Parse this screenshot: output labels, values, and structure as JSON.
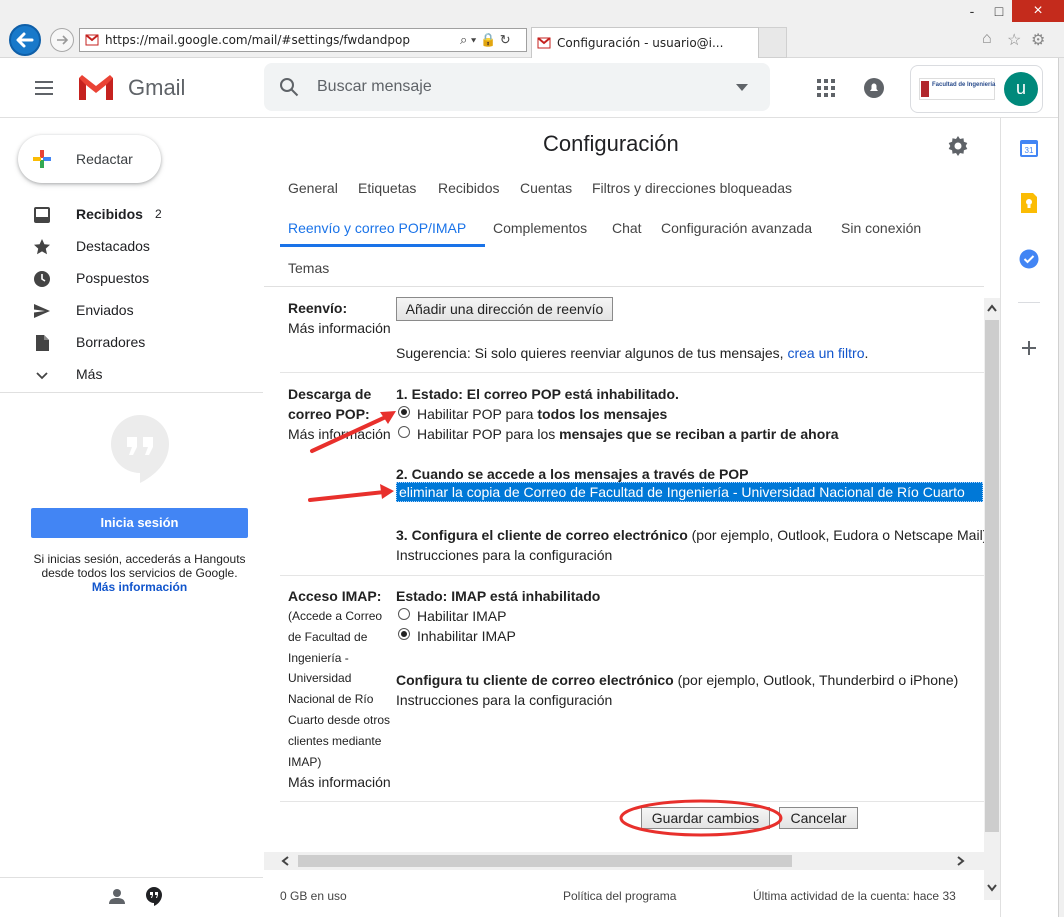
{
  "browser": {
    "url": "https://mail.google.com/mail/#settings/fwdandpop",
    "tab_title": "Configuración - usuario@i...",
    "window_buttons": [
      "-",
      "□",
      "×"
    ]
  },
  "header": {
    "app_name": "Gmail",
    "search_placeholder": "Buscar mensaje",
    "avatar_letter": "u",
    "account_logo_text": "Facultad de Ingeniería"
  },
  "sidebar": {
    "compose": "Redactar",
    "items": [
      {
        "label": "Recibidos",
        "count": "2",
        "icon": "inbox-icon"
      },
      {
        "label": "Destacados",
        "icon": "star-icon"
      },
      {
        "label": "Pospuestos",
        "icon": "clock-icon"
      },
      {
        "label": "Enviados",
        "icon": "send-icon"
      },
      {
        "label": "Borradores",
        "icon": "draft-icon"
      },
      {
        "label": "Más",
        "icon": "chevron-down-icon"
      }
    ],
    "hangouts": {
      "button": "Inicia sesión",
      "text": "Si inicias sesión, accederás a Hangouts desde todos los servicios de Google.",
      "link": "Más información"
    }
  },
  "settings": {
    "title": "Configuración",
    "tabs": [
      "General",
      "Etiquetas",
      "Recibidos",
      "Cuentas",
      "Filtros y direcciones bloqueadas",
      "Reenvío y correo POP/IMAP",
      "Complementos",
      "Chat",
      "Configuración avanzada",
      "Sin conexión",
      "Temas"
    ],
    "active_tab": "Reenvío y correo POP/IMAP",
    "forwarding": {
      "label": "Reenvío:",
      "more_info": "Más información",
      "button": "Añadir una dirección de reenvío",
      "hint_prefix": "Sugerencia: Si solo quieres reenviar algunos de tus mensajes, ",
      "hint_link": "crea un filtro",
      "hint_suffix": "."
    },
    "pop": {
      "label_line1": "Descarga de",
      "label_line2": "correo POP:",
      "more_info": "Más información",
      "status": "1. Estado: El correo POP está inhabilitado.",
      "option1_prefix": "Habilitar POP para ",
      "option1_bold": "todos los mensajes",
      "option2_prefix": "Habilitar POP para los ",
      "option2_bold": "mensajes que se reciban a partir de ahora",
      "selected_option": 1,
      "access_heading": "2. Cuando se accede a los mensajes a través de POP",
      "access_select": "eliminar la copia de Correo de Facultad de Ingeniería - Universidad Nacional de Río Cuarto",
      "client_heading": "3. Configura el cliente de correo electrónico",
      "client_suffix": " (por ejemplo, Outlook, Eudora o Netscape Mail)",
      "instructions": "Instrucciones para la configuración"
    },
    "imap": {
      "label": "Acceso IMAP:",
      "description_lines": [
        "(Accede a Correo",
        "de Facultad de",
        "Ingeniería -",
        "Universidad",
        "Nacional de Río",
        "Cuarto desde otros",
        "clientes mediante",
        "IMAP)"
      ],
      "more_info": "Más información",
      "status": "Estado: IMAP está inhabilitado",
      "option1": "Habilitar IMAP",
      "option2": "Inhabilitar IMAP",
      "selected_option": 2,
      "client_heading": "Configura tu cliente de correo electrónico",
      "client_suffix": " (por ejemplo, Outlook, Thunderbird o iPhone)",
      "instructions": "Instrucciones para la configuración"
    },
    "save_button": "Guardar cambios",
    "cancel_button": "Cancelar"
  },
  "footer": {
    "usage": "0 GB en uso",
    "policy": "Política del programa",
    "activity": "Última actividad de la cuenta: hace 33"
  },
  "annotation_color": "#e8302c",
  "accent_color": "#1a73e8"
}
